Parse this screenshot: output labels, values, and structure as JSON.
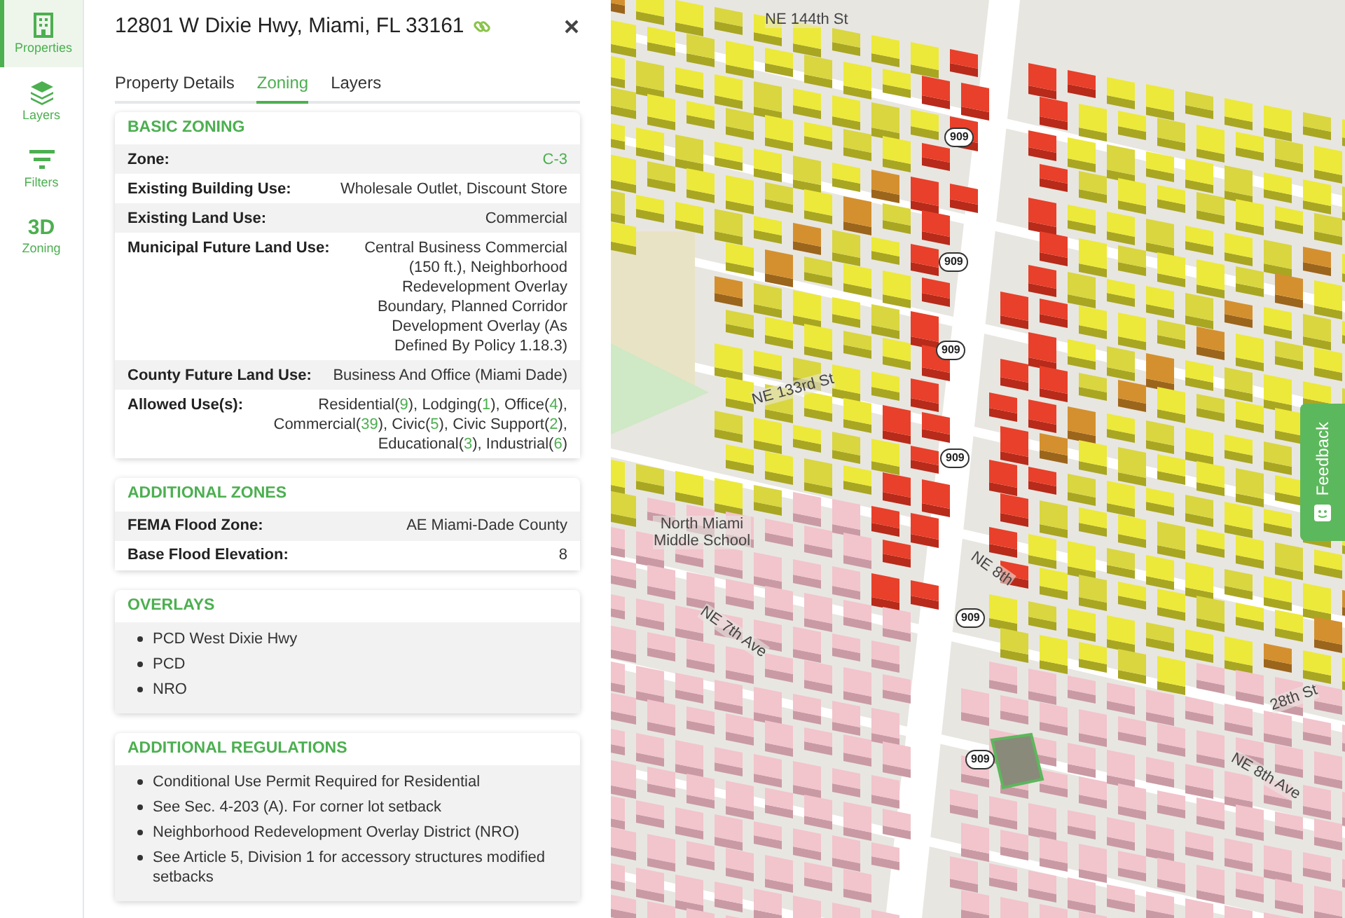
{
  "rail": [
    {
      "kind": "building",
      "label": "Properties",
      "selected": true
    },
    {
      "kind": "layers",
      "label": "Layers",
      "selected": false
    },
    {
      "kind": "filter",
      "label": "Filters",
      "selected": false
    },
    {
      "kind": "text",
      "glyph": "3D",
      "label": "Zoning",
      "selected": false
    }
  ],
  "panel": {
    "title": "12801 W Dixie Hwy, Miami, FL 33161",
    "tabs": [
      {
        "label": "Property Details",
        "selected": false
      },
      {
        "label": "Zoning",
        "selected": true
      },
      {
        "label": "Layers",
        "selected": false
      }
    ],
    "sections": [
      {
        "kind": "table",
        "title": "BASIC ZONING",
        "rows": [
          {
            "label": "Zone:",
            "value": "C-3",
            "highlight": true
          },
          {
            "label": "Existing Building Use:",
            "value": "Wholesale Outlet, Discount Store"
          },
          {
            "label": "Existing Land Use:",
            "value": "Commercial"
          },
          {
            "label": "Municipal Future Land Use:",
            "value": "Central Business Commercial (150 ft.), Neighborhood Redevelopment Overlay Boundary, Planned Corridor Development Overlay (As Defined By Policy 1.18.3)"
          },
          {
            "label": "County Future Land Use:",
            "value": "Business And Office (Miami Dade)"
          },
          {
            "label": "Allowed Use(s):",
            "uses": [
              {
                "name": "Residential(",
                "count": "9",
                "close": "),"
              },
              {
                "name": "Lodging(",
                "count": "1",
                "close": "),"
              },
              {
                "name": "Office(",
                "count": "4",
                "close": "),"
              },
              {
                "name": "Commercial(",
                "count": "39",
                "close": "),"
              },
              {
                "name": "Civic(",
                "count": "5",
                "close": "),"
              },
              {
                "name": "Civic Support(",
                "count": "2",
                "close": "),"
              },
              {
                "name": "Educational(",
                "count": "3",
                "close": "),"
              },
              {
                "name": "Industrial(",
                "count": "6",
                "close": ")"
              }
            ]
          }
        ]
      },
      {
        "kind": "table",
        "title": "ADDITIONAL ZONES",
        "rows": [
          {
            "label": "FEMA Flood Zone:",
            "value": "AE Miami-Dade County"
          },
          {
            "label": "Base Flood Elevation:",
            "value": "8"
          }
        ]
      },
      {
        "kind": "list",
        "title": "OVERLAYS",
        "items": [
          "PCD West Dixie Hwy",
          "PCD",
          "NRO"
        ]
      },
      {
        "kind": "list",
        "title": "ADDITIONAL REGULATIONS",
        "items": [
          "Conditional Use Permit Required for Residential",
          "See Sec. 4-203 (A). For corner lot setback",
          "Neighborhood Redevelopment Overlay District (NRO)",
          "See Article 5, Division 1 for accessory structures modified setbacks"
        ]
      }
    ]
  },
  "map": {
    "labels": [
      "NE 144th St",
      "NE 133rd St",
      "North Miami Middle School",
      "NE 8th",
      "NE 7th Ave",
      "28th St",
      "NE 8th Ave"
    ],
    "shields": [
      "909",
      "909",
      "909",
      "909",
      "909",
      "909"
    ],
    "feedback": "Feedback"
  }
}
